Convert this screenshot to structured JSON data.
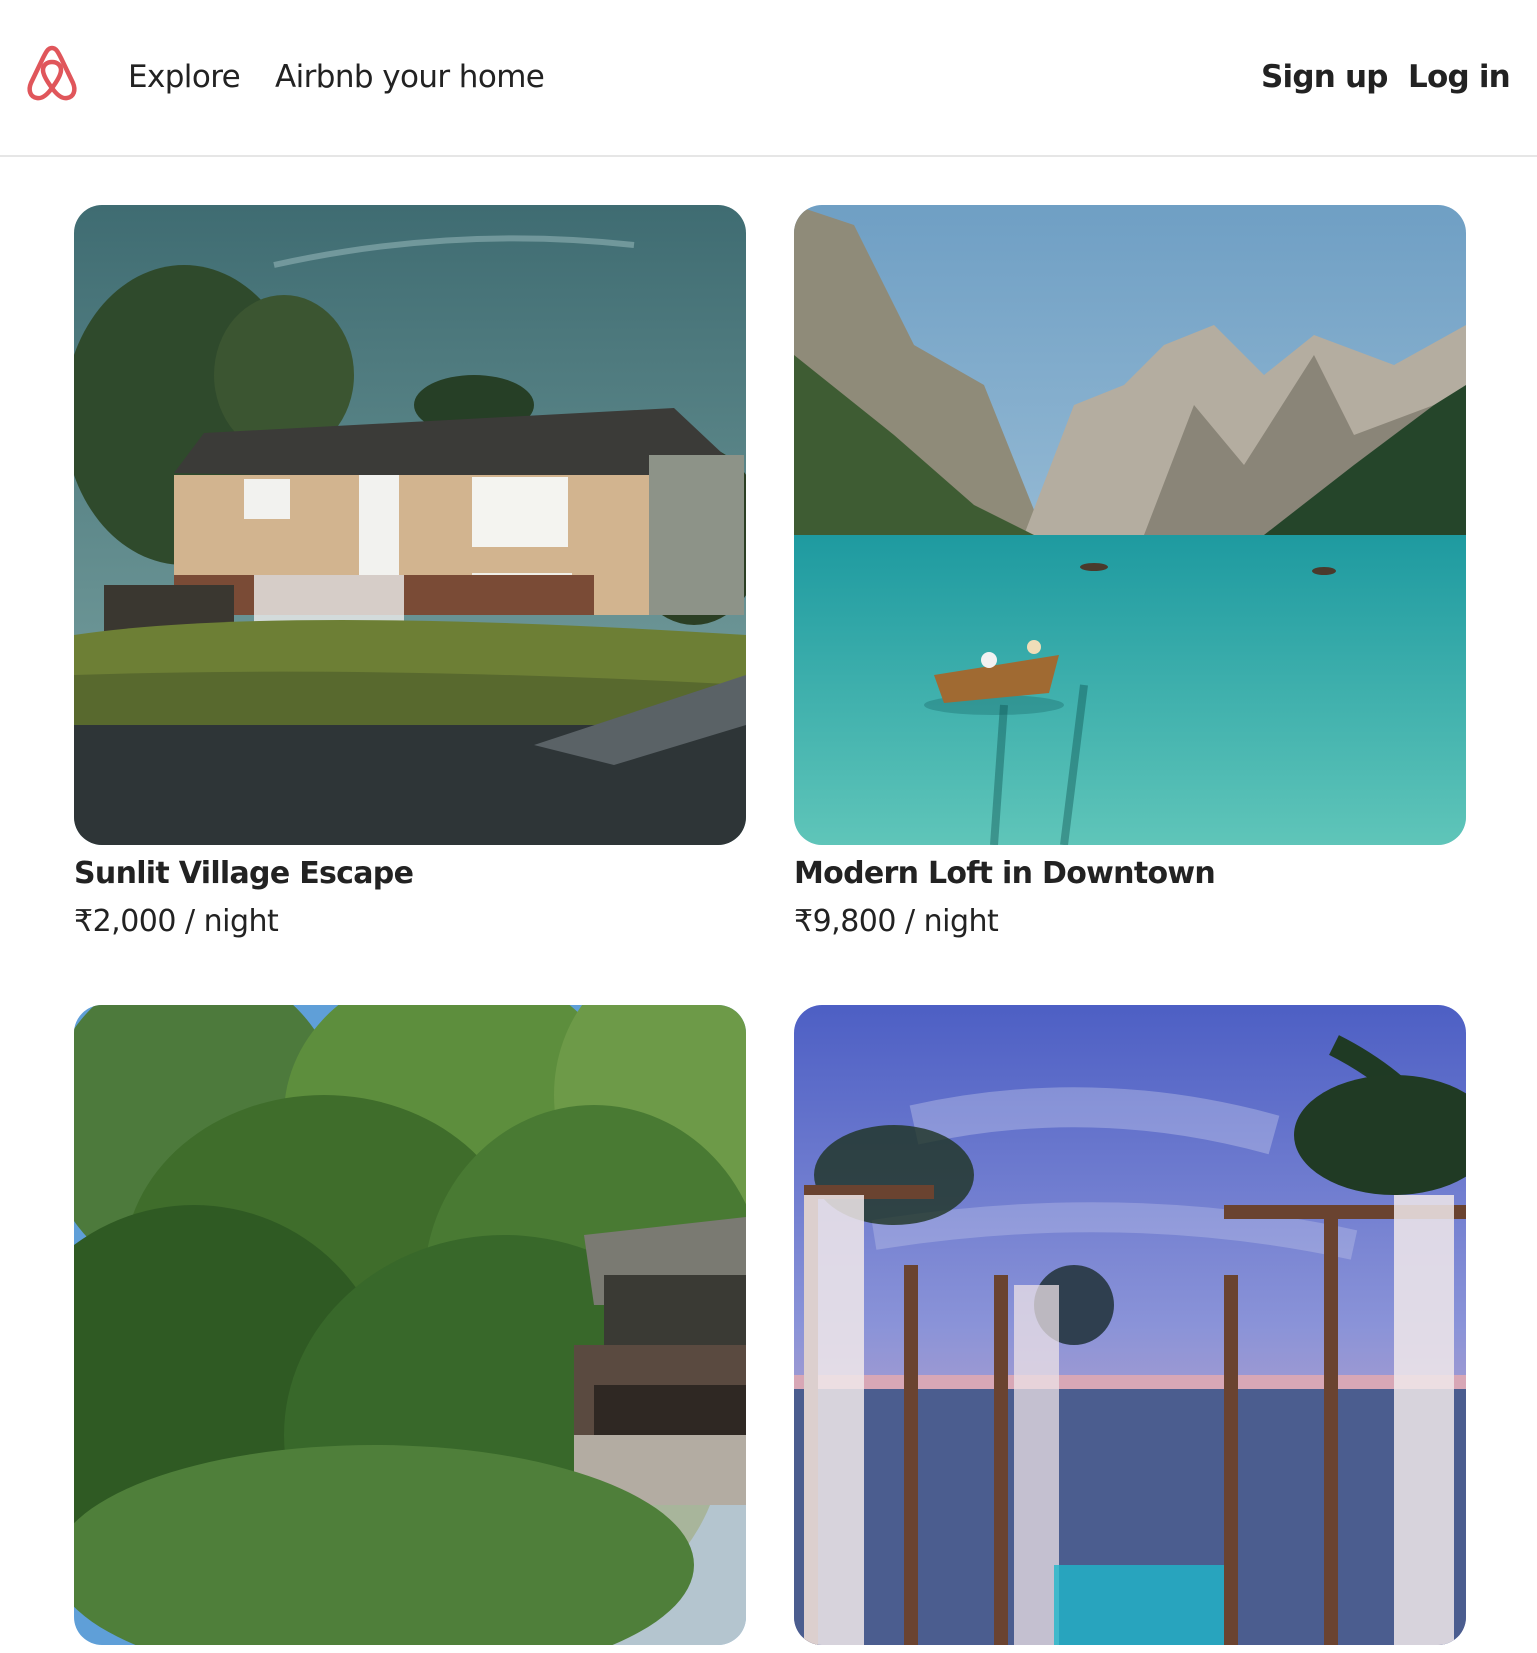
{
  "brand": {
    "logo_icon": "airbnb-logo-icon",
    "accent_color": "#e0565b"
  },
  "header": {
    "nav": [
      {
        "label": "Explore"
      },
      {
        "label": "Airbnb your home"
      }
    ],
    "sign_up_label": "Sign up",
    "log_in_label": "Log in"
  },
  "listings": [
    {
      "title": "Sunlit Village Escape",
      "price": "₹2,000 / night"
    },
    {
      "title": "Modern Loft in Downtown",
      "price": "₹9,800 / night"
    },
    {
      "title": "",
      "price": ""
    },
    {
      "title": "",
      "price": ""
    }
  ]
}
